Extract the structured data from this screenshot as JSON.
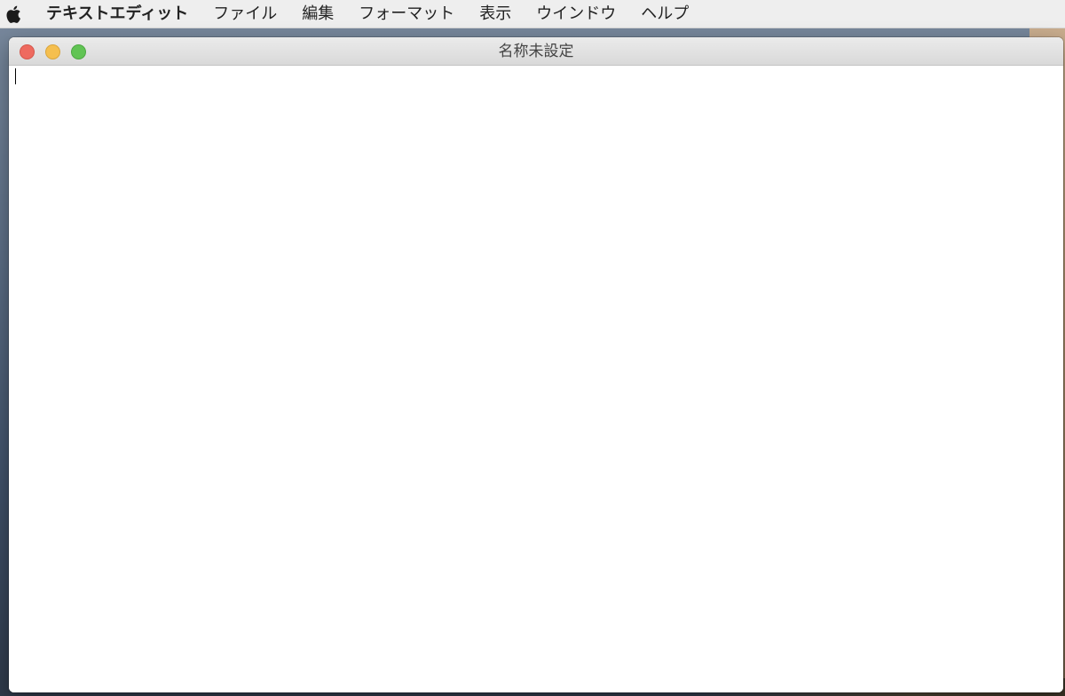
{
  "menubar": {
    "apple_icon": "apple-logo-icon",
    "app_name": "テキストエディット",
    "items": [
      {
        "label": "ファイル"
      },
      {
        "label": "編集"
      },
      {
        "label": "フォーマット"
      },
      {
        "label": "表示"
      },
      {
        "label": "ウインドウ"
      },
      {
        "label": "ヘルプ"
      }
    ]
  },
  "window": {
    "title": "名称未設定",
    "traffic_colors": {
      "close": "#ee6a5f",
      "minimize": "#f5bf4f",
      "zoom": "#61c454"
    },
    "document_text": ""
  }
}
